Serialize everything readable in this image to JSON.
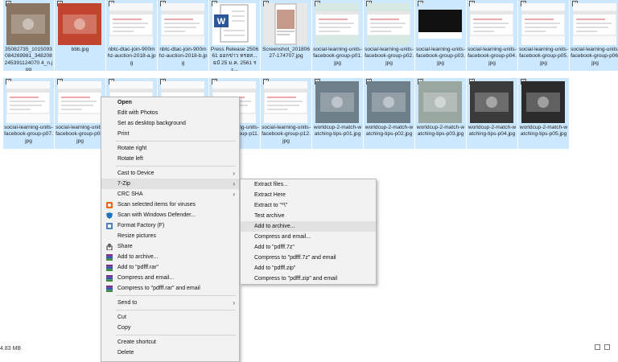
{
  "files": [
    {
      "caption": "35082735_1015093084269981_348208245391124070 4_n.jpg",
      "thumb": "photo",
      "thumb_color": "#8a7561"
    },
    {
      "caption": "bbb.jpg",
      "thumb": "photo",
      "thumb_color": "#c0442e"
    },
    {
      "caption": "nbtc-dtac-join-900mhz-auction-2018-a.jpg",
      "thumb": "web",
      "thumb_color": "#f7f7f7"
    },
    {
      "caption": "nbtc-dtac-join-900mhz-auction-2018-b.jpg",
      "thumb": "web",
      "thumb_color": "#f7f7f7"
    },
    {
      "caption": "Press Release 250661 ออกข่าว ทรฮส... ฉบั 25 ม.ค. 2561 ระ...",
      "thumb": "doc",
      "thumb_color": "#ffffff"
    },
    {
      "caption": "Screenshot_20180627-174707.jpg",
      "thumb": "phone",
      "thumb_color": "#e8e8e8"
    },
    {
      "caption": "social-learning-units-facebook-group-p01.jpg",
      "thumb": "web",
      "thumb_color": "#d7e9e3"
    },
    {
      "caption": "social-learning-units-facebook-group-p02.jpg",
      "thumb": "web",
      "thumb_color": "#d7e9e3"
    },
    {
      "caption": "social-learning-units-facebook-group-p03.jpg",
      "thumb": "dark",
      "thumb_color": "#111111"
    },
    {
      "caption": "social-learning-units-facebook-group-p04.jpg",
      "thumb": "web",
      "thumb_color": "#fafafa"
    },
    {
      "caption": "social-learning-units-facebook-group-p05.jpg",
      "thumb": "web",
      "thumb_color": "#fafafa"
    },
    {
      "caption": "social-learning-units-facebook-group-p06.jpg",
      "thumb": "web",
      "thumb_color": "#fafafa"
    },
    {
      "caption": "social-learning-units-facebook-group-p07.jpg",
      "thumb": "web",
      "thumb_color": "#fafafa"
    },
    {
      "caption": "social-learning-units-facebook-group-p08.jpg",
      "thumb": "web",
      "thumb_color": "#fafafa"
    },
    {
      "caption": "",
      "thumb": "web",
      "thumb_color": "#fafafa"
    },
    {
      "caption": "",
      "thumb": "web",
      "thumb_color": "#fafafa"
    },
    {
      "caption": "social-learning-units-facebook-group-p11.jpg",
      "thumb": "web",
      "thumb_color": "#fafafa"
    },
    {
      "caption": "social-learning-units-facebook-group-p12.jpg",
      "thumb": "web",
      "thumb_color": "#fafafa"
    },
    {
      "caption": "worldcup-2-match-watching-tips-p01.jpg",
      "thumb": "photo",
      "thumb_color": "#6f7f8a"
    },
    {
      "caption": "worldcup-2-match-watching-tips-p02.jpg",
      "thumb": "photo",
      "thumb_color": "#6f7f8a"
    },
    {
      "caption": "worldcup-2-match-watching-tips-p03.jpg",
      "thumb": "photo",
      "thumb_color": "#9aa6a0"
    },
    {
      "caption": "worldcup-2-match-watching-tips-p04.jpg",
      "thumb": "photo",
      "thumb_color": "#3b3b3b"
    },
    {
      "caption": "worldcup-2-match-watching-tips-p05.jpg",
      "thumb": "photo",
      "thumb_color": "#2b2b2b"
    }
  ],
  "context_menu": [
    {
      "label": "Open",
      "bold": true
    },
    {
      "label": "Edit with Photos"
    },
    {
      "label": "Set as desktop background"
    },
    {
      "label": "Print"
    },
    {
      "sep": true
    },
    {
      "label": "Rotate right"
    },
    {
      "label": "Rotate left"
    },
    {
      "sep": true
    },
    {
      "label": "Cast to Device",
      "submenu": true
    },
    {
      "label": "7-Zip",
      "submenu": true,
      "highlight": true
    },
    {
      "label": "CRC SHA",
      "submenu": true
    },
    {
      "label": "Scan selected items for viruses",
      "icon": "defender-icon"
    },
    {
      "label": "Scan with Windows Defender...",
      "icon": "defender-shield-icon"
    },
    {
      "label": "Format Factory (F)",
      "icon": "format-factory-icon"
    },
    {
      "label": "Resize pictures"
    },
    {
      "label": "Share",
      "icon": "share-icon"
    },
    {
      "label": "Add to archive...",
      "icon": "winrar-icon"
    },
    {
      "label": "Add to \"pdfff.rar\"",
      "icon": "winrar-icon"
    },
    {
      "label": "Compress and email...",
      "icon": "winrar-icon"
    },
    {
      "label": "Compress to \"pdfff.rar\" and email",
      "icon": "winrar-icon"
    },
    {
      "sep": true
    },
    {
      "label": "Send to",
      "submenu": true
    },
    {
      "sep": true
    },
    {
      "label": "Cut"
    },
    {
      "label": "Copy"
    },
    {
      "sep": true
    },
    {
      "label": "Create shortcut"
    },
    {
      "label": "Delete"
    }
  ],
  "zip_menu": [
    {
      "label": "Extract files..."
    },
    {
      "label": "Extract Here"
    },
    {
      "label": "Extract to \"*\\\""
    },
    {
      "label": "Test archive"
    },
    {
      "label": "Add to archive...",
      "highlight": true
    },
    {
      "label": "Compress and email..."
    },
    {
      "label": "Add to \"pdfff.7z\""
    },
    {
      "label": "Compress to \"pdfff.7z\" and email"
    },
    {
      "label": "Add to \"pdfff.zip\""
    },
    {
      "label": "Compress to \"pdfff.zip\" and email"
    }
  ],
  "status": {
    "size_text": "4.83 MB"
  },
  "colors": {
    "selection": "#cce8ff",
    "menu_bg": "#f2f2f2",
    "menu_highlight": "#e1e1e1"
  }
}
